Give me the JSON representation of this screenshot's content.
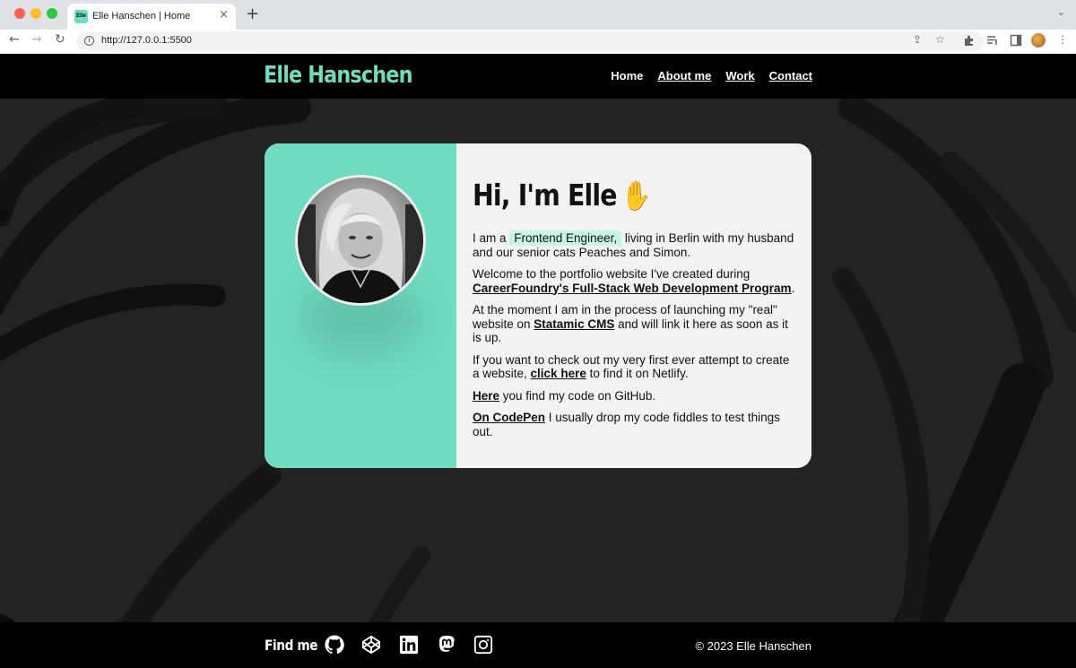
{
  "browser": {
    "tab_title": "Elle Hanschen | Home",
    "favicon_text": "Elle",
    "url": "http://127.0.0.1:5500"
  },
  "header": {
    "brand": "Elle Hanschen",
    "nav": [
      {
        "label": "Home"
      },
      {
        "label": "About me"
      },
      {
        "label": "Work"
      },
      {
        "label": "Contact"
      }
    ]
  },
  "card": {
    "heading": "Hi, I'm Elle",
    "wave_emoji": "✋",
    "p1_before": "I am a ",
    "p1_highlight": "Frontend Engineer,",
    "p1_after": " living in Berlin with my husband and our senior cats Peaches and Simon.",
    "p2_before": "Welcome to the portfolio website I've created during ",
    "p2_link": "CareerFoundry's Full-Stack Web Development Program",
    "p2_after": ".",
    "p3_before": "At the moment I am in the process of launching my \"real\" website on ",
    "p3_link": "Statamic CMS",
    "p3_after": " and will link it here as soon as it is up.",
    "p4_before": "If you want to check out my very first ever attempt to create a website, ",
    "p4_link": "click here",
    "p4_after": " to find it on Netlify.",
    "p5_link": "Here",
    "p5_after": " you find my code on GitHub.",
    "p6_link": "On CodePen",
    "p6_after": " I usually drop my code fiddles to test things out."
  },
  "footer": {
    "find_me": "Find me",
    "social_icons": [
      "github-icon",
      "codepen-icon",
      "linkedin-icon",
      "mastodon-icon",
      "instagram-icon"
    ],
    "copyright": "© 2023 Elle Hanschen"
  },
  "colors": {
    "accent": "#6fdbc0",
    "header_bg": "#000000",
    "card_bg": "#f2f2f2"
  }
}
